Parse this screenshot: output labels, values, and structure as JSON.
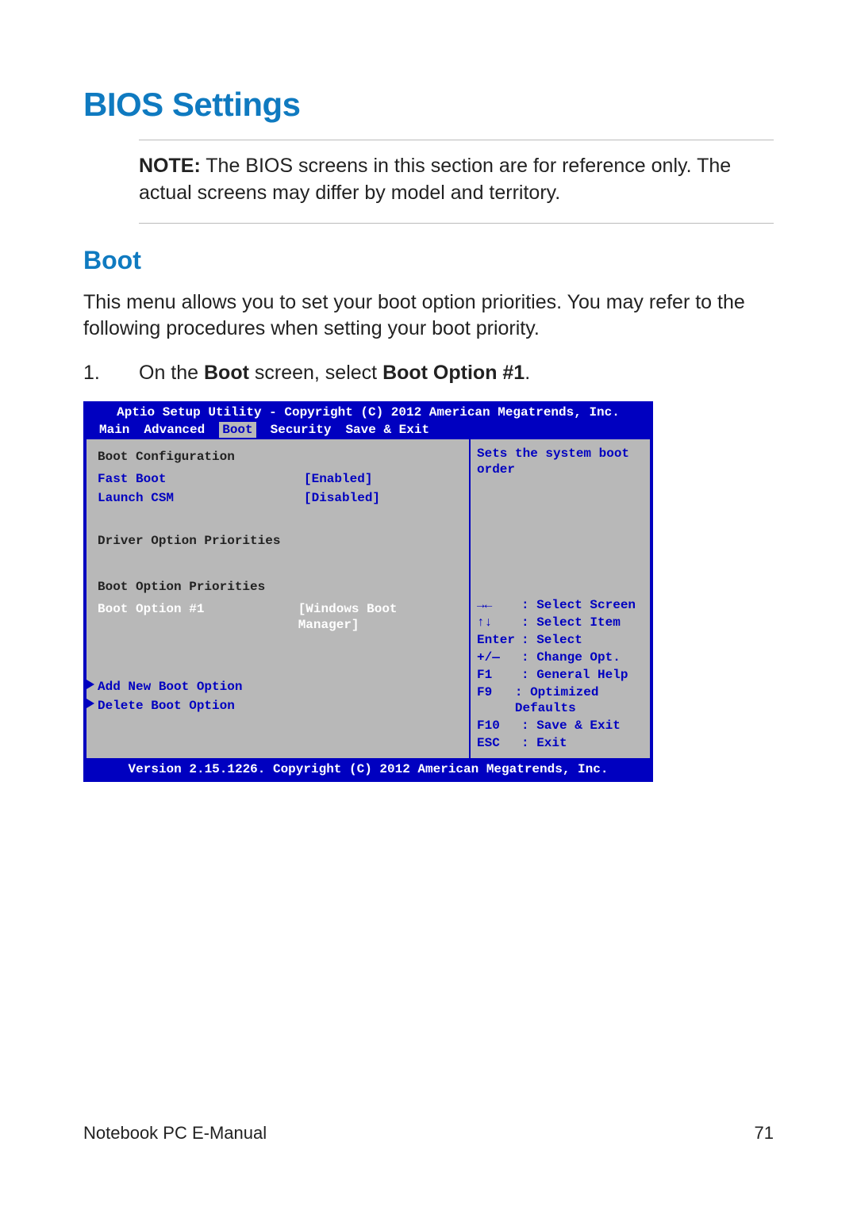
{
  "heading": "BIOS Settings",
  "note": {
    "label": "NOTE:",
    "text": "The BIOS screens in this section are for reference only. The actual screens may differ by model and territory."
  },
  "subheading": "Boot",
  "intro": "This menu allows you to set your boot option priorities. You may refer to the following procedures when setting your boot priority.",
  "step1": {
    "num": "1.",
    "pre": "On the ",
    "b1": "Boot",
    "mid": " screen, select ",
    "b2": "Boot Option #1",
    "post": "."
  },
  "bios": {
    "title": "Aptio Setup Utility - Copyright (C) 2012 American Megatrends, Inc.",
    "menu": [
      "Main",
      "Advanced",
      "Boot",
      "Security",
      "Save & Exit"
    ],
    "activeMenu": "Boot",
    "left": {
      "bootConfig": "Boot Configuration",
      "fastBoot": {
        "k": "Fast Boot",
        "v": "[Enabled]"
      },
      "launchCsm": {
        "k": "Launch CSM",
        "v": "[Disabled]"
      },
      "driverOpt": "Driver Option Priorities",
      "bootOptHdr": "Boot Option Priorities",
      "bootOpt1": {
        "k": "Boot Option #1",
        "v": "[Windows Boot Manager]"
      },
      "addNew": "Add New Boot Option",
      "deleteOpt": "Delete Boot Option"
    },
    "right": {
      "desc": "Sets the system boot order",
      "keys": [
        {
          "k": "→← ",
          "v": ": Select Screen"
        },
        {
          "k": "↑↓  ",
          "v": ": Select Item"
        },
        {
          "k": "Enter",
          "v": ": Select"
        },
        {
          "k": "+/— ",
          "v": ": Change Opt."
        },
        {
          "k": "F1  ",
          "v": ": General Help"
        },
        {
          "k": "F9  ",
          "v": ": Optimized Defaults"
        },
        {
          "k": "F10 ",
          "v": ": Save & Exit"
        },
        {
          "k": "ESC ",
          "v": ": Exit"
        }
      ]
    },
    "footer": "Version 2.15.1226. Copyright (C) 2012 American Megatrends, Inc."
  },
  "footer": {
    "left": "Notebook PC E-Manual",
    "right": "71"
  }
}
